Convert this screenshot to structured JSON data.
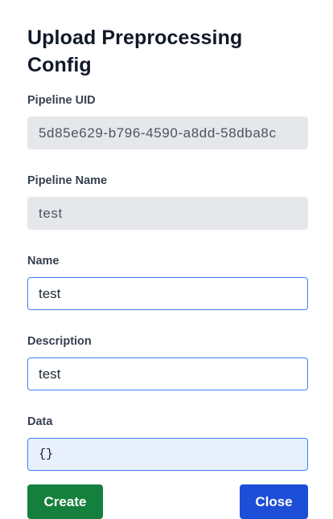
{
  "dialog": {
    "title": "Upload Preprocessing Config"
  },
  "fields": {
    "pipeline_uid": {
      "label": "Pipeline UID",
      "value": "5d85e629-b796-4590-a8dd-58dba8c"
    },
    "pipeline_name": {
      "label": "Pipeline Name",
      "value": "test"
    },
    "name": {
      "label": "Name",
      "value": "test"
    },
    "description": {
      "label": "Description",
      "value": "test"
    },
    "data": {
      "label": "Data",
      "value": "{}"
    }
  },
  "buttons": {
    "create_label": "Create",
    "close_label": "Close"
  },
  "colors": {
    "create_button": "#15803d",
    "close_button": "#1d4ed8",
    "focus_border": "#3b82f6",
    "readonly_background": "#e5e7eb"
  }
}
